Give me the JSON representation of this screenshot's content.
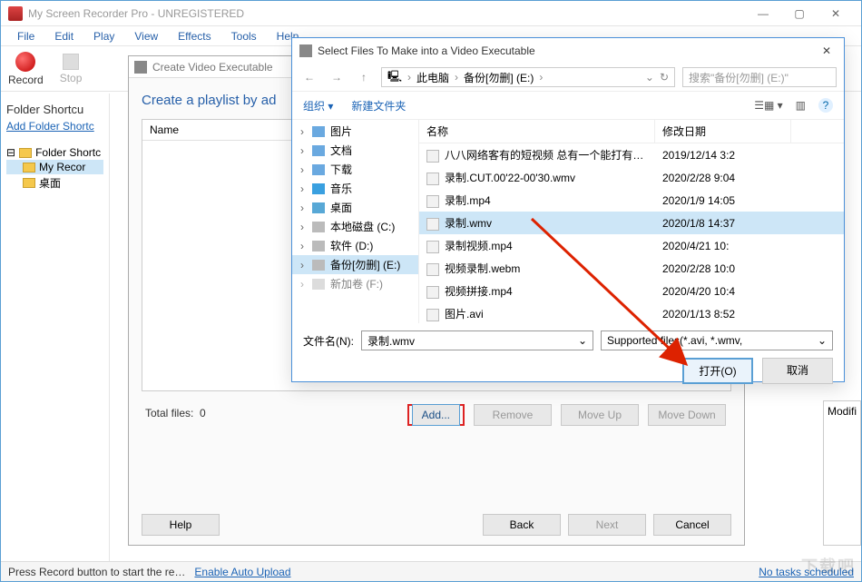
{
  "app": {
    "title": "My Screen Recorder Pro - UNREGISTERED",
    "win_min": "—",
    "win_max": "▢",
    "win_close": "✕"
  },
  "menu": {
    "file": "File",
    "edit": "Edit",
    "play": "Play",
    "view": "View",
    "effects": "Effects",
    "tools": "Tools",
    "help": "Help"
  },
  "toolbar": {
    "record": "Record",
    "stop": "Stop"
  },
  "left": {
    "heading": "Folder Shortcu",
    "add_link": "Add Folder Shortc",
    "tree_root": "Folder Shortc",
    "tree_sel": "My Recor",
    "tree_desktop": "桌面"
  },
  "playlist": {
    "window_title": "Create Video Executable",
    "heading": "Create a playlist by ad",
    "col_name": "Name",
    "col_modified": "Modifi",
    "total_label": "Total files:",
    "total_val": "0",
    "add": "Add...",
    "remove": "Remove",
    "moveup": "Move Up",
    "movedown": "Move Down",
    "help": "Help",
    "back": "Back",
    "next": "Next",
    "cancel": "Cancel"
  },
  "filedlg": {
    "title": "Select Files To Make into a Video Executable",
    "crumb_pc": "此电脑",
    "crumb_drive": "备份[勿删] (E:)",
    "search_placeholder": "搜索\"备份[勿删] (E:)\"",
    "organize": "组织",
    "newfolder": "新建文件夹",
    "tree": {
      "pictures": "图片",
      "documents": "文档",
      "downloads": "下载",
      "music": "音乐",
      "desktop": "桌面",
      "localc": "本地磁盘 (C:)",
      "softd": "软件 (D:)",
      "backupe": "备份[勿删] (E:)",
      "newvol": "新加卷 (F:)"
    },
    "col_name": "名称",
    "col_date": "修改日期",
    "rows": [
      {
        "name": "八八网络客有的短视频 总有一个能打有…",
        "date": "2019/12/14 3:2"
      },
      {
        "name": "录制.CUT.00'22-00'30.wmv",
        "date": "2020/2/28 9:04"
      },
      {
        "name": "录制.mp4",
        "date": "2020/1/9 14:05"
      },
      {
        "name": "录制.wmv",
        "date": "2020/1/8 14:37"
      },
      {
        "name": "录制视频.mp4",
        "date": "2020/4/21 10:"
      },
      {
        "name": "视频录制.webm",
        "date": "2020/2/28 10:0"
      },
      {
        "name": "视频拼接.mp4",
        "date": "2020/4/20 10:4"
      },
      {
        "name": "图片.avi",
        "date": "2020/1/13 8:52"
      }
    ],
    "filename_label": "文件名(N):",
    "filename_value": "录制.wmv",
    "filetype": "Supported files(*.avi, *.wmv,",
    "open": "打开(O)",
    "cancel": "取消"
  },
  "status": {
    "left": "Press Record button to start the re…",
    "auto_upload": "Enable Auto Upload",
    "right": "No tasks scheduled"
  },
  "modif_label": "Modifi",
  "watermark": "下载吧"
}
